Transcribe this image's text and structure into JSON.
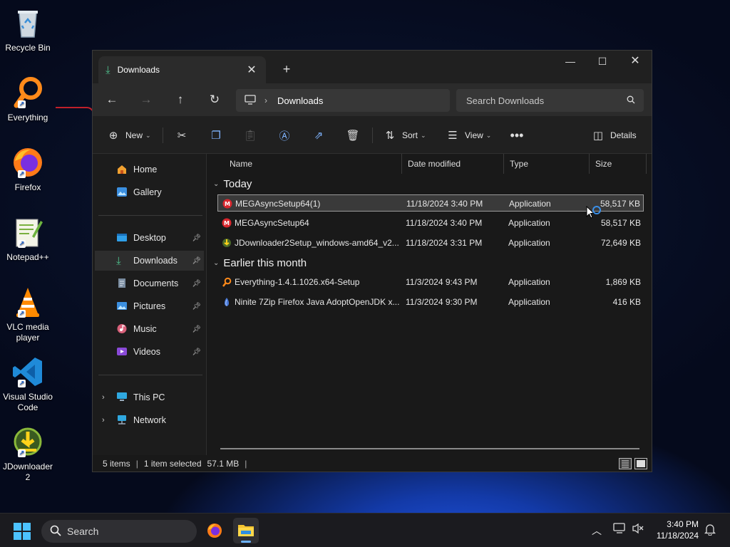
{
  "desktop": {
    "icons": [
      {
        "label": "Recycle Bin"
      },
      {
        "label": "Everything"
      },
      {
        "label": "Firefox"
      },
      {
        "label": "Notepad++"
      },
      {
        "label": "VLC media player"
      },
      {
        "label": "Visual Studio Code"
      },
      {
        "label": "JDownloader 2"
      }
    ]
  },
  "window": {
    "tab_title": "Downloads",
    "nav": {
      "address_label": "Downloads",
      "search_placeholder": "Search Downloads"
    },
    "toolbar": {
      "new_label": "New",
      "sort_label": "Sort",
      "view_label": "View",
      "details_label": "Details"
    },
    "sidebar": {
      "home": "Home",
      "gallery": "Gallery",
      "desktop": "Desktop",
      "downloads": "Downloads",
      "documents": "Documents",
      "pictures": "Pictures",
      "music": "Music",
      "videos": "Videos",
      "this_pc": "This PC",
      "network": "Network"
    },
    "columns": {
      "name": "Name",
      "date": "Date modified",
      "type": "Type",
      "size": "Size"
    },
    "groups": {
      "today": "Today",
      "earlier": "Earlier this month"
    },
    "files": [
      {
        "name": "MEGAsyncSetup64(1)",
        "date": "11/18/2024 3:40 PM",
        "type": "Application",
        "size": "58,517 KB"
      },
      {
        "name": "MEGAsyncSetup64",
        "date": "11/18/2024 3:40 PM",
        "type": "Application",
        "size": "58,517 KB"
      },
      {
        "name": "JDownloader2Setup_windows-amd64_v2...",
        "date": "11/18/2024 3:31 PM",
        "type": "Application",
        "size": "72,649 KB"
      },
      {
        "name": "Everything-1.4.1.1026.x64-Setup",
        "date": "11/3/2024 9:43 PM",
        "type": "Application",
        "size": "1,869 KB"
      },
      {
        "name": "Ninite 7Zip Firefox Java AdoptOpenJDK x...",
        "date": "11/3/2024 9:30 PM",
        "type": "Application",
        "size": "416 KB"
      }
    ],
    "status": {
      "items": "5 items",
      "selected": "1 item selected",
      "selected_size": "57.1 MB"
    }
  },
  "taskbar": {
    "search_placeholder": "Search",
    "time": "3:40 PM",
    "date": "11/18/2024"
  }
}
